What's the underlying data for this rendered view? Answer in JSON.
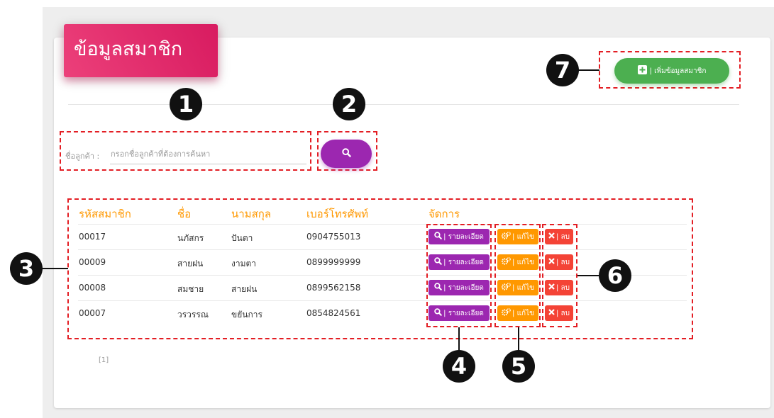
{
  "page": {
    "title": "ข้อมูลสมาชิก",
    "accent_color": "#e91e63"
  },
  "search": {
    "label": "ชื่อลูกค้า :",
    "placeholder": "กรอกชื่อลูกค้าที่ต้องการค้นหา",
    "value": "",
    "button_icon": "search-icon"
  },
  "add_button": {
    "icon": "plus-square-icon",
    "label": "| เพิ่มข้อมูลสมาชิก"
  },
  "table": {
    "headers": [
      "รหัสสมาชิก",
      "ชื่อ",
      "นามสกุล",
      "เบอร์โทรศัพท์",
      "จัดการ"
    ],
    "rows": [
      {
        "id": "00017",
        "first": "นภัสกร",
        "last": "ปันตา",
        "phone": "0904755013"
      },
      {
        "id": "00009",
        "first": "สายฝน",
        "last": "งามตา",
        "phone": "0899999999"
      },
      {
        "id": "00008",
        "first": "สมชาย",
        "last": "สายฝน",
        "phone": "0899562158"
      },
      {
        "id": "00007",
        "first": "วรวรรณ",
        "last": "ขยันการ",
        "phone": "0854824561"
      }
    ],
    "actions": {
      "detail_label": "| รายละเอียด",
      "edit_label": "| แก้ไข",
      "delete_label": "| ลบ"
    }
  },
  "pagination": {
    "text": "[1]"
  },
  "callouts": [
    "1",
    "2",
    "3",
    "4",
    "5",
    "6",
    "7"
  ],
  "colors": {
    "detail": "#9c27b0",
    "edit": "#ff9800",
    "delete": "#f44336",
    "add": "#4caf50",
    "header_text": "#ff9800",
    "annotation": "#e31e24"
  }
}
